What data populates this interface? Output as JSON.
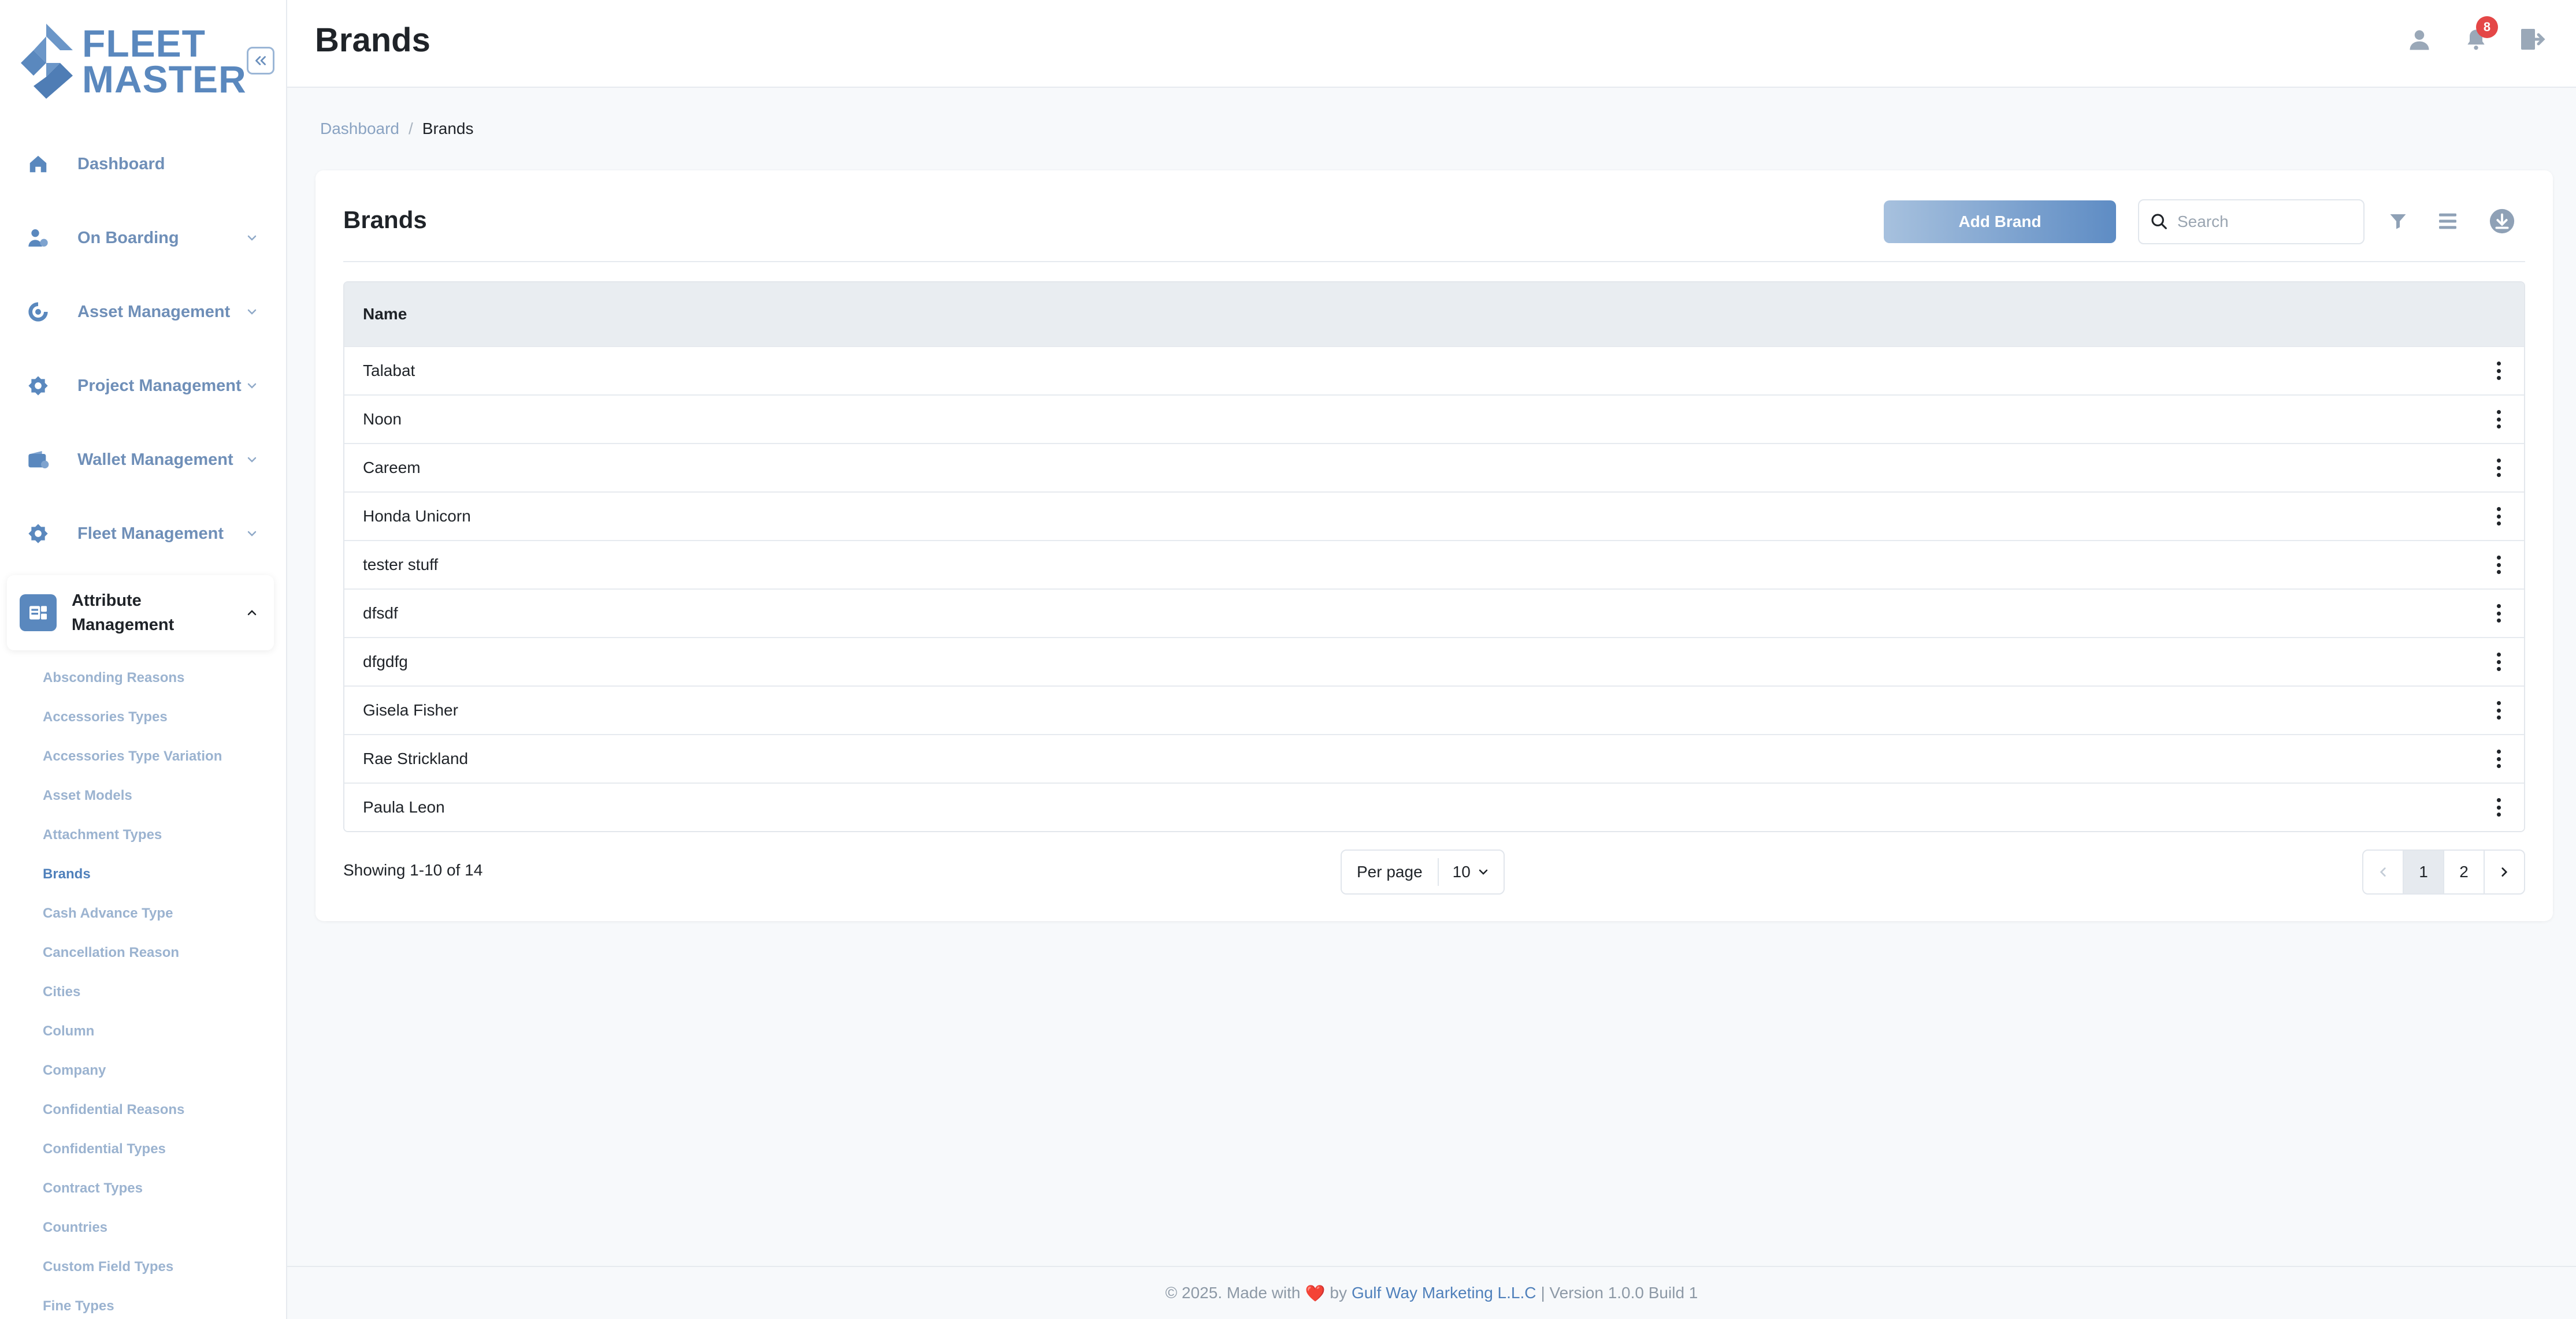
{
  "app": {
    "logo_line1": "FLEET",
    "logo_line2": "MASTER"
  },
  "sidebar": {
    "items": [
      {
        "label": "Dashboard",
        "icon": "home-icon"
      },
      {
        "label": "On Boarding",
        "icon": "user-onboarding-icon"
      },
      {
        "label": "Asset Management",
        "icon": "asset-icon"
      },
      {
        "label": "Project Management",
        "icon": "project-icon"
      },
      {
        "label": "Wallet Management",
        "icon": "wallet-icon"
      },
      {
        "label": "Fleet Management",
        "icon": "fleet-icon"
      },
      {
        "label": "Attribute Management",
        "icon": "attribute-icon",
        "expanded": true
      }
    ],
    "sub_items": [
      "Absconding Reasons",
      "Accessories Types",
      "Accessories Type Variation",
      "Asset Models",
      "Attachment Types",
      "Brands",
      "Cash Advance Type",
      "Cancellation Reason",
      "Cities",
      "Column",
      "Company",
      "Confidential Reasons",
      "Confidential Types",
      "Contract Types",
      "Countries",
      "Custom Field Types",
      "Fine Types"
    ],
    "current_sub_item": "Brands"
  },
  "header": {
    "title": "Brands",
    "notification_count": "8"
  },
  "breadcrumb": {
    "home": "Dashboard",
    "separator": "/",
    "current": "Brands"
  },
  "card": {
    "title": "Brands",
    "add_button": "Add Brand",
    "search_placeholder": "Search"
  },
  "table": {
    "columns": [
      "Name"
    ],
    "rows": [
      "Talabat",
      "Noon",
      "Careem",
      "Honda Unicorn",
      "tester stuff",
      "dfsdf",
      "dfgdfg",
      "Gisela Fisher",
      "Rae Strickland",
      "Paula Leon"
    ]
  },
  "pagination": {
    "showing": "Showing 1-10 of 14",
    "per_page_label": "Per page",
    "per_page_value": "10",
    "pages": [
      "1",
      "2"
    ],
    "current_page": "1"
  },
  "footer": {
    "prefix": "© 2025. Made with",
    "by": "by",
    "company": "Gulf Way Marketing L.L.C",
    "version": "| Version 1.0.0 Build 1"
  },
  "colors": {
    "accent": "#5a88be",
    "badge": "#e44747"
  }
}
